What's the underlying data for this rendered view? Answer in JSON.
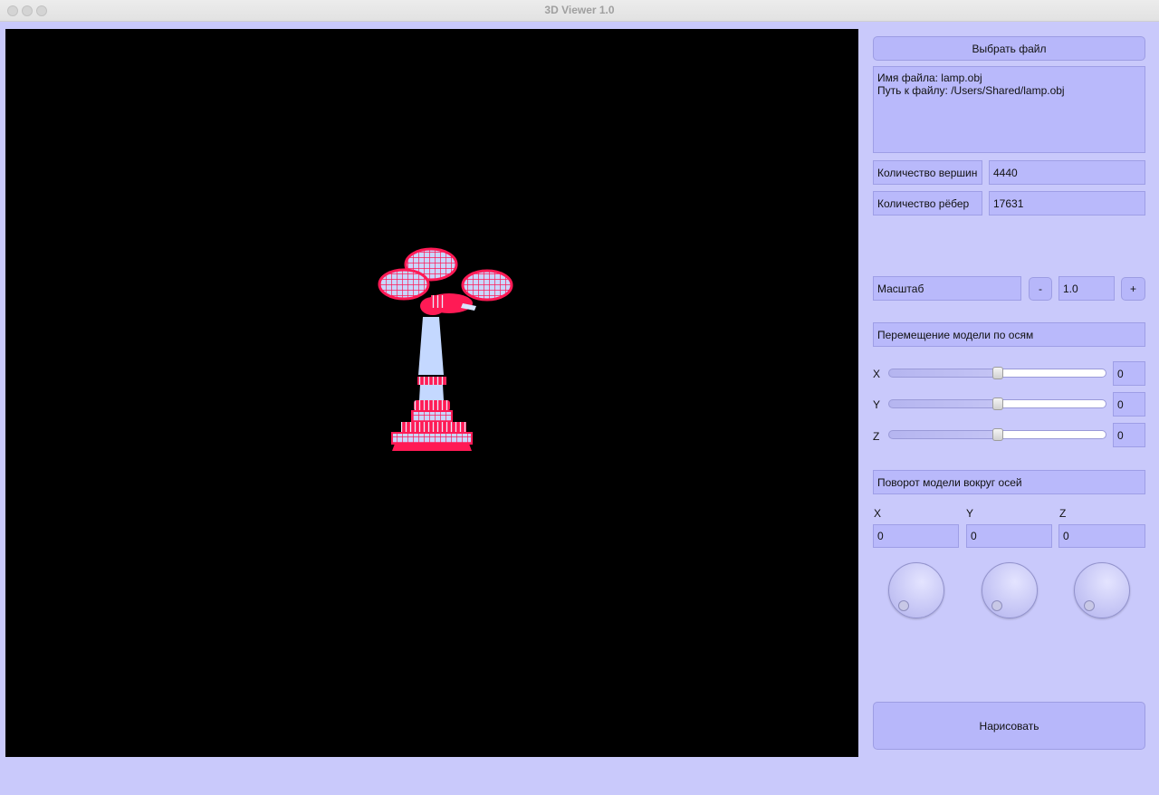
{
  "window": {
    "title": "3D Viewer 1.0"
  },
  "file": {
    "choose_button": "Выбрать файл",
    "name_line": "Имя файла: lamp.obj",
    "path_line": "Путь к файлу: /Users/Shared/lamp.obj"
  },
  "stats": {
    "vertices_label": "Количество вершин",
    "vertices_value": "4440",
    "edges_label": "Количество рёбер",
    "edges_value": "17631"
  },
  "scale": {
    "label": "Масштаб",
    "minus": "-",
    "value": "1.0",
    "plus": "+"
  },
  "translate": {
    "header": "Перемещение модели по осям",
    "x_label": "X",
    "x_value": "0",
    "y_label": "Y",
    "y_value": "0",
    "z_label": "Z",
    "z_value": "0",
    "slider_level": 0.5
  },
  "rotate": {
    "header": "Поворот модели вокруг осей",
    "x_label": "X",
    "x_value": "0",
    "y_label": "Y",
    "y_value": "0",
    "z_label": "Z",
    "z_value": "0"
  },
  "draw_button": "Нарисовать",
  "colors": {
    "background": "#c9c9fb",
    "panel": "#b9b9fb",
    "viewport": "#000000",
    "model_edges": "#ff1a55",
    "model_faces": "#c0d8ff"
  }
}
